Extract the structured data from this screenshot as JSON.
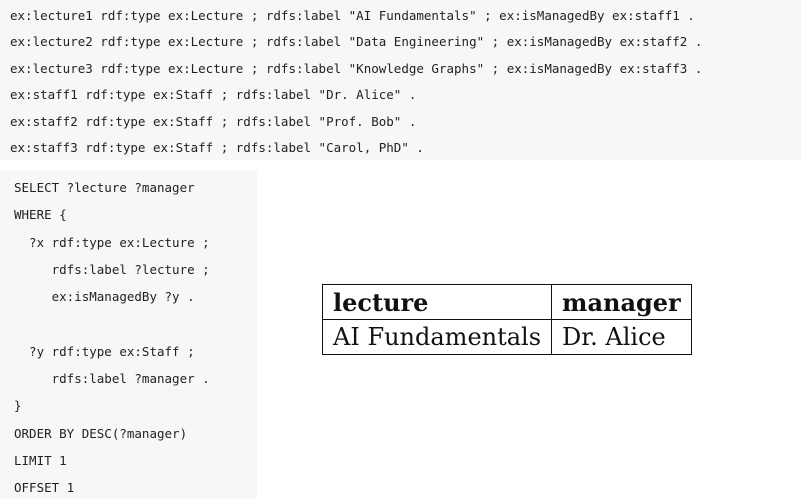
{
  "triples": [
    "ex:lecture1 rdf:type ex:Lecture ; rdfs:label \"AI Fundamentals\" ; ex:isManagedBy ex:staff1 .",
    "ex:lecture2 rdf:type ex:Lecture ; rdfs:label \"Data Engineering\" ; ex:isManagedBy ex:staff2 .",
    "ex:lecture3 rdf:type ex:Lecture ; rdfs:label \"Knowledge Graphs\" ; ex:isManagedBy ex:staff3 .",
    "ex:staff1 rdf:type ex:Staff ; rdfs:label \"Dr. Alice\" .",
    "ex:staff2 rdf:type ex:Staff ; rdfs:label \"Prof. Bob\" .",
    "ex:staff3 rdf:type ex:Staff ; rdfs:label \"Carol, PhD\" ."
  ],
  "query": [
    "SELECT ?lecture ?manager",
    "WHERE {",
    "  ?x rdf:type ex:Lecture ;",
    "     rdfs:label ?lecture ;",
    "     ex:isManagedBy ?y .",
    "",
    "  ?y rdf:type ex:Staff ;",
    "     rdfs:label ?manager .",
    "}",
    "ORDER BY DESC(?manager)",
    "LIMIT 1",
    "OFFSET 1"
  ],
  "result_table": {
    "headers": [
      "lecture",
      "manager"
    ],
    "rows": [
      [
        "AI Fundamentals",
        "Dr. Alice"
      ]
    ]
  }
}
